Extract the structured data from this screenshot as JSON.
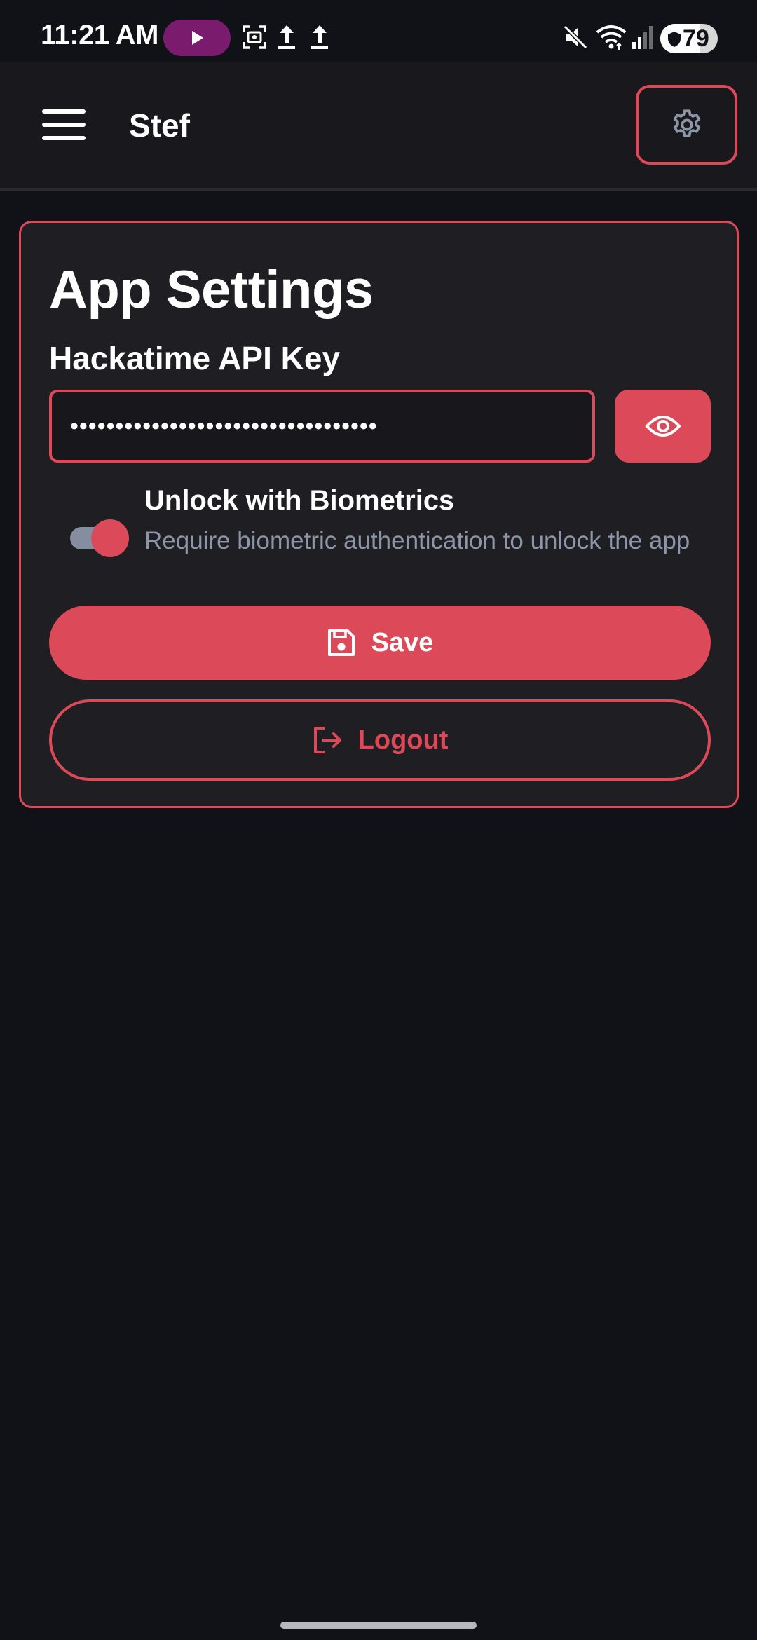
{
  "status_bar": {
    "time": "11:21 AM",
    "battery_level": "79",
    "icons": [
      "play-icon",
      "screenshot-icon",
      "upload-icon",
      "upload-icon",
      "mute-icon",
      "wifi-icon",
      "signal-icon",
      "shield-icon"
    ]
  },
  "app_bar": {
    "title": "Stef",
    "menu_icon": "hamburger-menu-icon",
    "settings_icon": "gear-icon"
  },
  "settings": {
    "title": "App Settings",
    "api_key_label": "Hackatime API Key",
    "api_key_value": "••••••••••••••••••••••••••••••••••",
    "reveal_icon": "eye-icon",
    "biometrics_title": "Unlock with Biometrics",
    "biometrics_desc": "Require biometric authentication to unlock the app",
    "biometrics_enabled": true,
    "save_label": "Save",
    "save_icon": "floppy-disk-icon",
    "logout_label": "Logout",
    "logout_icon": "logout-icon"
  },
  "colors": {
    "accent": "#dc4a5a",
    "background": "#111217",
    "card": "#1f1e23",
    "muted_text": "#8c96a8"
  }
}
